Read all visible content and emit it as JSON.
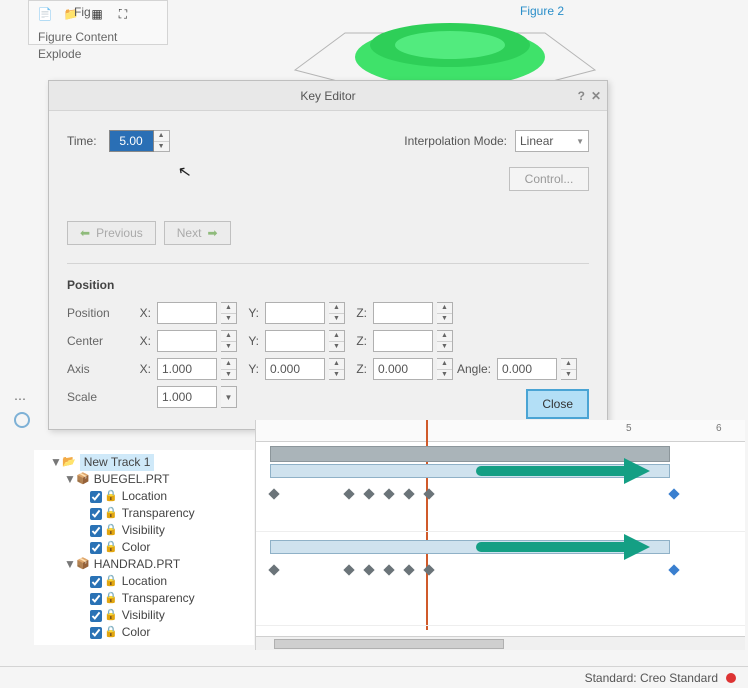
{
  "toolbar": {
    "fig_tab": "Fig",
    "figure_content": "Figure Content",
    "explode": "Explode"
  },
  "viewport": {
    "figure_title": "Figure 2"
  },
  "key_editor": {
    "title": "Key Editor",
    "time_label": "Time:",
    "time_value": "5.00",
    "interp_label": "Interpolation Mode:",
    "interp_value": "Linear",
    "control_btn": "Control...",
    "prev_btn": "Previous",
    "next_btn": "Next",
    "close_btn": "Close",
    "position_section": "Position",
    "rows": {
      "position": {
        "label": "Position",
        "x": "",
        "y": "",
        "z": ""
      },
      "center": {
        "label": "Center",
        "x": "",
        "y": "",
        "z": ""
      },
      "axis": {
        "label": "Axis",
        "x": "1.000",
        "y": "0.000",
        "z": "0.000",
        "angle_label": "Angle:",
        "angle": "0.000"
      },
      "scale": {
        "label": "Scale",
        "value": "1.000"
      }
    },
    "axis_labels": {
      "x": "X:",
      "y": "Y:",
      "z": "Z:"
    }
  },
  "tree": {
    "track": "New Track 1",
    "parts": [
      {
        "name": "BUEGEL.PRT",
        "props": [
          "Location",
          "Transparency",
          "Visibility",
          "Color"
        ]
      },
      {
        "name": "HANDRAD.PRT",
        "props": [
          "Location",
          "Transparency",
          "Visibility",
          "Color"
        ]
      }
    ]
  },
  "timeline": {
    "ruler_ticks": [
      "5",
      "6"
    ],
    "key_positions_1": [
      0,
      75,
      95,
      115,
      135,
      155,
      400
    ],
    "key_positions_2": [
      0,
      75,
      95,
      115,
      135,
      155,
      400
    ]
  },
  "status": {
    "standard": "Standard: Creo Standard"
  }
}
